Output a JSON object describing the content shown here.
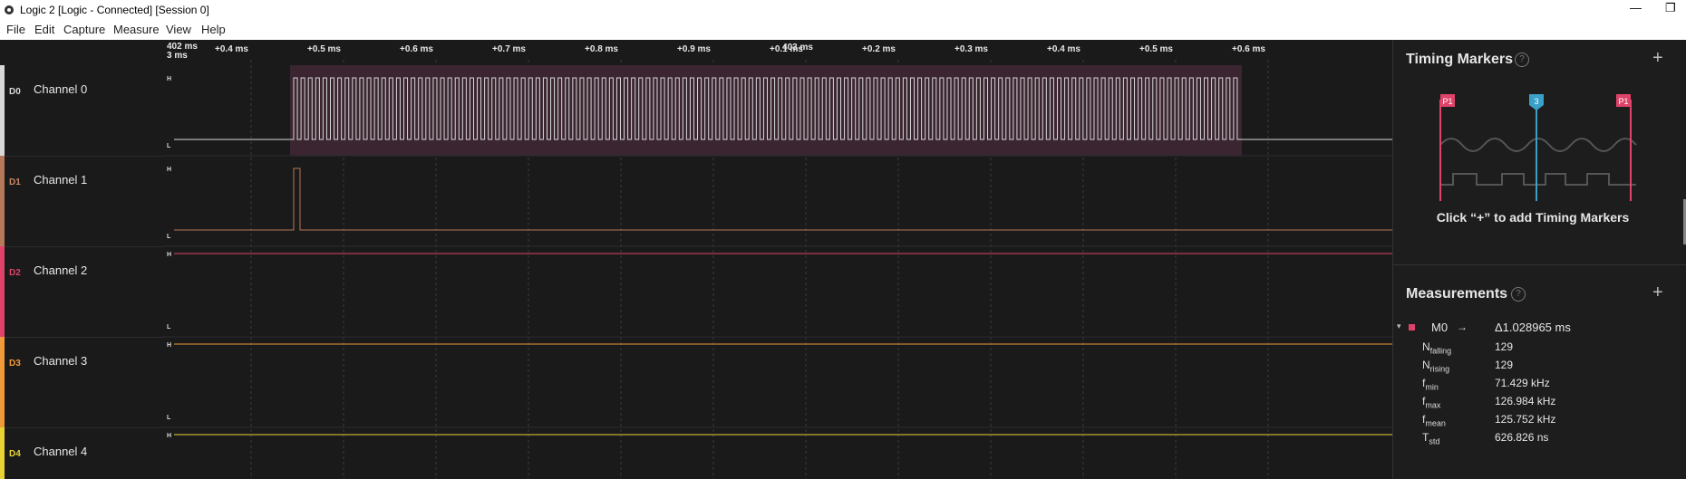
{
  "window": {
    "title": "Logic 2 [Logic - Connected] [Session 0]",
    "minimize": "—",
    "restore": "❐"
  },
  "menu": [
    {
      "label": "File"
    },
    {
      "label": "Edit"
    },
    {
      "label": "Capture"
    },
    {
      "label": "Measure"
    },
    {
      "label": "View"
    },
    {
      "label": "Help"
    }
  ],
  "timeline": {
    "left_time": "402 ms",
    "left_time_sub": "3 ms",
    "center_time": "403 ms",
    "ticks": [
      "+0.4 ms",
      "+0.5 ms",
      "+0.6 ms",
      "+0.7 ms",
      "+0.8 ms",
      "+0.9 ms",
      "+0.1 ms",
      "+0.2 ms",
      "+0.3 ms",
      "+0.4 ms",
      "+0.5 ms",
      "+0.6 ms"
    ]
  },
  "channels": [
    {
      "id": "D0",
      "name": "Channel 0",
      "color": "#d8d8d8",
      "id_color": "#d8d8d8",
      "signal": "clock"
    },
    {
      "id": "D1",
      "name": "Channel 1",
      "color": "#b5785a",
      "id_color": "#c98765",
      "signal": "pulse"
    },
    {
      "id": "D2",
      "name": "Channel 2",
      "color": "#e0436a",
      "id_color": "#e0436a",
      "signal": "high"
    },
    {
      "id": "D3",
      "name": "Channel 3",
      "color": "#f09a3a",
      "id_color": "#f09a3a",
      "signal": "high"
    },
    {
      "id": "D4",
      "name": "Channel 4",
      "color": "#e8d234",
      "id_color": "#e8d234",
      "signal": "high"
    }
  ],
  "level_labels": {
    "high": "H",
    "low": "L"
  },
  "timing_markers": {
    "title": "Timing Markers",
    "help": "?",
    "add": "+",
    "hint": "Click “+” to add Timing Markers",
    "illustration": {
      "left_flag": "P1",
      "center_flag": "3",
      "right_flag": "P1"
    }
  },
  "measurements": {
    "title": "Measurements",
    "help": "?",
    "add": "+",
    "entry": {
      "name": "M0",
      "arrow": "→",
      "delta": "Δ1.028965 ms",
      "color": "#e0436a",
      "rows": [
        {
          "sym": "N",
          "sub": "falling",
          "value": "129"
        },
        {
          "sym": "N",
          "sub": "rising",
          "value": "129"
        },
        {
          "sym": "f",
          "sub": "min",
          "value": "71.429 kHz"
        },
        {
          "sym": "f",
          "sub": "max",
          "value": "126.984 kHz"
        },
        {
          "sym": "f",
          "sub": "mean",
          "value": "125.752 kHz"
        },
        {
          "sym": "T",
          "sub": "std",
          "value": "626.826 ns"
        }
      ]
    }
  },
  "colors": {
    "background": "#1a1a1a",
    "selection": "#3a2530",
    "accent": "#e0436a",
    "marker_blue": "#3aa0c8"
  }
}
